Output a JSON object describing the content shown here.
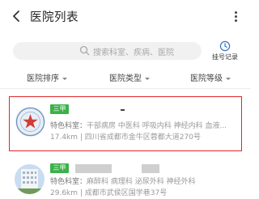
{
  "header": {
    "title": "医院列表"
  },
  "search": {
    "placeholder": "搜索科室、疾病、医院"
  },
  "history": {
    "label": "挂号记录"
  },
  "filters": [
    {
      "label": "医院排序"
    },
    {
      "label": "医院类型"
    },
    {
      "label": "医院等级"
    }
  ],
  "hospitals": [
    {
      "badge": "三甲",
      "specialty_label": "特色科室：",
      "specialties": "干部病房 中医科 呼吸内科 神经内科 血液...",
      "distance_address": "17.4km | 四川省成都市金牛区蓉都大道270号"
    },
    {
      "badge": "三甲",
      "specialty_label": "特色科室：",
      "specialties": "麻醉科 病理科 泌尿外科 神经外科",
      "distance_address": "29.6km | 成都市武侯区国学巷37号"
    }
  ],
  "colors": {
    "badge": "#3bb14a",
    "highlight_border": "#e0262b"
  },
  "icons": [
    "back-arrow-icon",
    "more-dots-icon",
    "search-icon",
    "clock-icon",
    "caret-down-icon",
    "hospital-emblem-icon",
    "hospital-building-icon"
  ]
}
